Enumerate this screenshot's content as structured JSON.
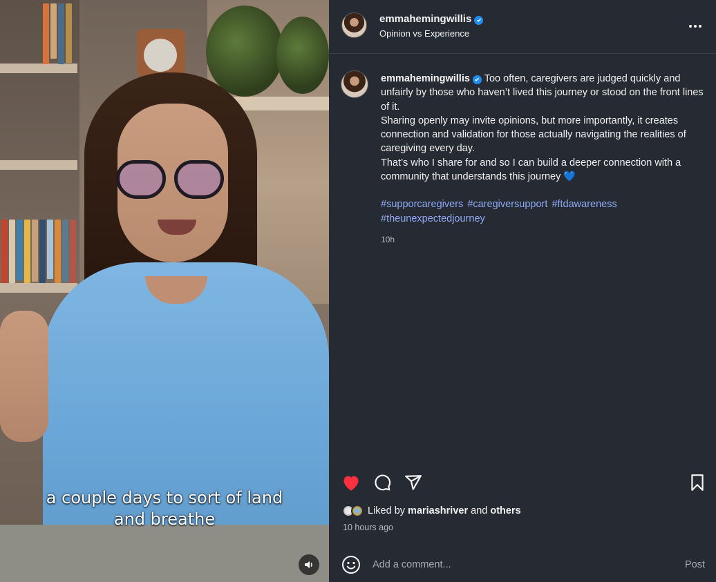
{
  "video": {
    "caption_line1": "a couple days to sort of land",
    "caption_line2": "and breathe",
    "mute_icon": "speaker-icon"
  },
  "header": {
    "username": "emmahemingwillis",
    "subtitle": "Opinion vs Experience",
    "verified": true,
    "more_icon": "more-horizontal-icon"
  },
  "post": {
    "username": "emmahemingwillis",
    "lines": [
      "Too often, caregivers are judged quickly and unfairly by those who haven’t lived this journey or stood on the front lines of it.",
      "Sharing openly may invite opinions, but more importantly, it creates connection and validation for those actually navigating the realities of caregiving every day.",
      "That’s who I share for and so I can build a deeper connection with a community that understands this journey"
    ],
    "heart_emoji": "💙",
    "hashtags": [
      "#supporcaregivers",
      "#caregiversupport",
      "#ftdawareness",
      "#theunexpectedjourney"
    ],
    "time": "10h"
  },
  "actions": {
    "like_icon": "heart-filled-icon",
    "comment_icon": "comment-icon",
    "share_icon": "share-icon",
    "save_icon": "bookmark-icon",
    "like_color": "#ff3040"
  },
  "likes": {
    "prefix": "Liked by",
    "user": "mariashriver",
    "conjunction": "and",
    "others": "others",
    "time_ago": "10 hours ago"
  },
  "comment": {
    "placeholder": "Add a comment...",
    "post_label": "Post",
    "emoji_icon": "smiley-icon"
  },
  "colors": {
    "panel_bg": "#262a33",
    "hashtag": "#8fa9f5",
    "verified": "#1f8cf2"
  }
}
